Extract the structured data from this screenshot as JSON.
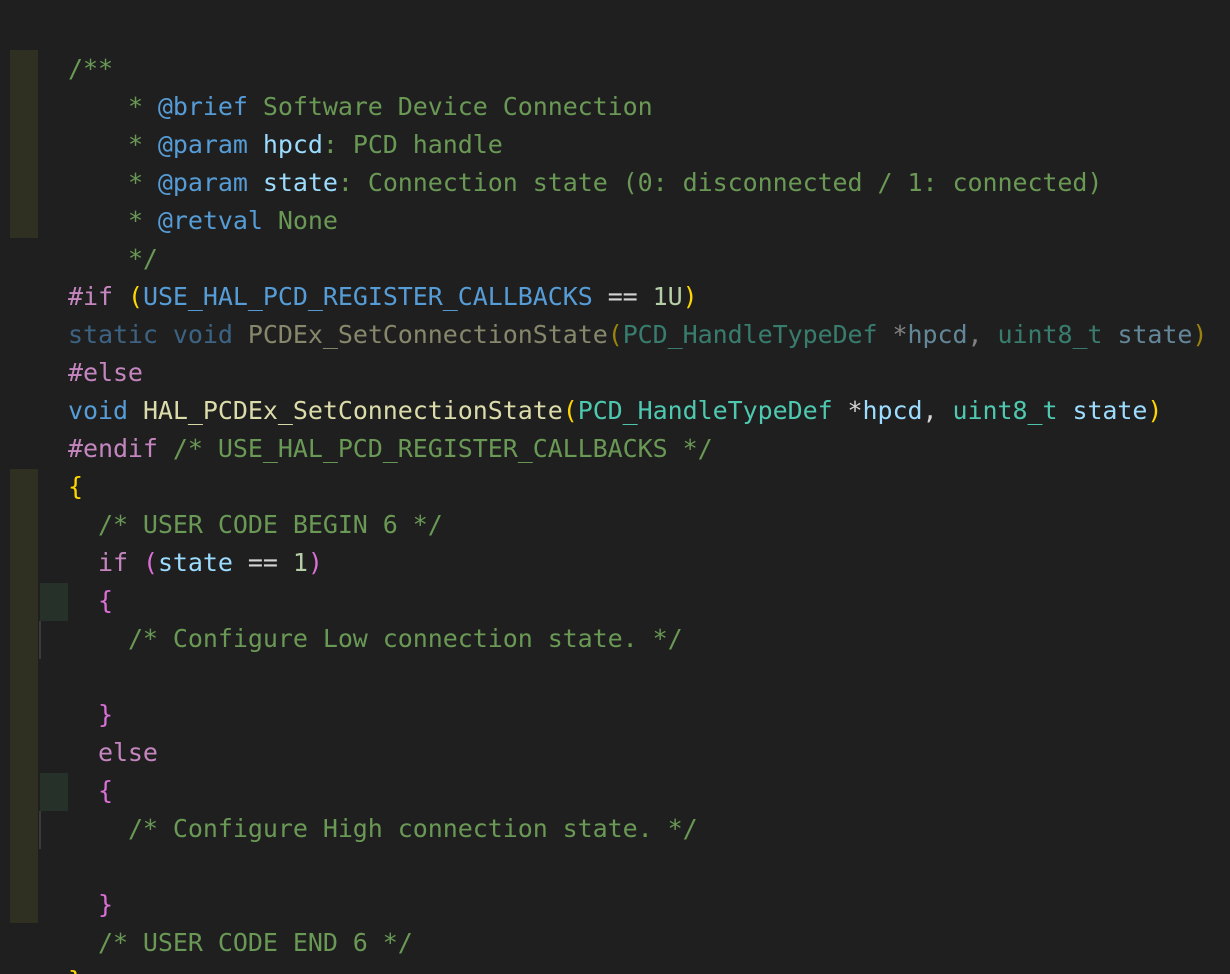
{
  "editor": {
    "theme": {
      "background": "#1f1f1f",
      "comment": "#6a9955",
      "keyword": "#569cd6",
      "control": "#c586c0",
      "type": "#4ec9b0",
      "function": "#dcdcaa",
      "variable": "#9cdcfe",
      "number": "#b5cea8",
      "bracket_gold": "#ffd700",
      "bracket_pink": "#da70d6"
    },
    "lines": {
      "l1": {
        "open": "/**"
      },
      "l2": {
        "star": "* ",
        "tag": "@brief",
        "text": " Software Device Connection"
      },
      "l3": {
        "star": "* ",
        "tag": "@param",
        "sp": " ",
        "name": "hpcd",
        "text": ": PCD handle"
      },
      "l4": {
        "star": "* ",
        "tag": "@param",
        "sp": " ",
        "name": "state",
        "text": ": Connection state (0: disconnected / 1: connected)"
      },
      "l5": {
        "star": "* ",
        "tag": "@retval",
        "text": " None"
      },
      "l6": {
        "close": "*/"
      },
      "l7": {
        "directive": "#if",
        "sp": " ",
        "lp": "(",
        "macro": "USE_HAL_PCD_REGISTER_CALLBACKS",
        "op": " == ",
        "num": "1U",
        "rp": ")"
      },
      "l8": {
        "kw1": "static",
        "sp1": " ",
        "kw2": "void",
        "sp2": " ",
        "fn": "PCDEx_SetConnectionState",
        "lp": "(",
        "type1": "PCD_HandleTypeDef",
        "ptr": " *",
        "arg1": "hpcd",
        "comma": ", ",
        "type2": "uint8_t",
        "sp3": " ",
        "arg2": "state",
        "rp": ")"
      },
      "l9": {
        "directive": "#else"
      },
      "l10": {
        "kw": "void",
        "sp1": " ",
        "fn": "HAL_PCDEx_SetConnectionState",
        "lp": "(",
        "type1": "PCD_HandleTypeDef",
        "ptr": " *",
        "arg1": "hpcd",
        "comma": ", ",
        "type2": "uint8_t",
        "sp2": " ",
        "arg2": "state",
        "rp": ")"
      },
      "l11": {
        "directive": "#endif",
        "comment": " /* USE_HAL_PCD_REGISTER_CALLBACKS */"
      },
      "l12": {
        "brace": "{"
      },
      "l13": {
        "comment": "/* USER CODE BEGIN 6 */"
      },
      "l14": {
        "kw": "if",
        "sp": " ",
        "lp": "(",
        "var": "state",
        "op": " == ",
        "num": "1",
        "rp": ")"
      },
      "l15": {
        "brace": "{"
      },
      "l16": {
        "comment": "/* Configure Low connection state. */"
      },
      "l18": {
        "brace": "}"
      },
      "l19": {
        "kw": "else"
      },
      "l20": {
        "brace": "{"
      },
      "l21": {
        "comment": "/* Configure High connection state. */"
      },
      "l23": {
        "brace": "}"
      },
      "l24": {
        "comment": "/* USER CODE END 6 */"
      },
      "l25": {
        "brace": "}"
      }
    }
  }
}
